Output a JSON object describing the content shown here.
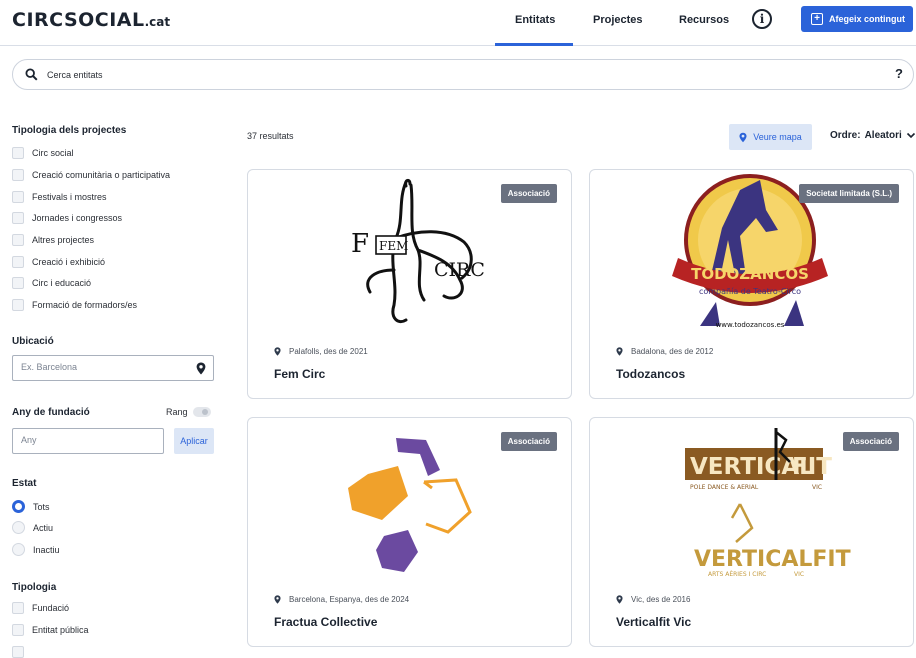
{
  "brand": {
    "name": "CIRCSOCIAL",
    "suffix": ".cat"
  },
  "nav": {
    "tabs": [
      "Entitats",
      "Projectes",
      "Recursos"
    ],
    "active": "Entitats",
    "add_label": "Afegeix contingut",
    "info": "i"
  },
  "search": {
    "placeholder": "Cerca entitats",
    "help": "?"
  },
  "filters": {
    "project_types": {
      "title": "Tipologia dels projectes",
      "items": [
        "Circ social",
        "Creació comunitària o participativa",
        "Festivals i mostres",
        "Jornades i congressos",
        "Altres projectes",
        "Creació i exhibició",
        "Circ i educació",
        "Formació de formadors/es"
      ]
    },
    "location": {
      "title": "Ubicació",
      "placeholder": "Ex. Barcelona"
    },
    "founding": {
      "title": "Any de fundació",
      "range_label": "Rang",
      "placeholder": "Any",
      "apply": "Aplicar"
    },
    "status": {
      "title": "Estat",
      "options": [
        "Tots",
        "Actiu",
        "Inactiu"
      ],
      "selected": "Tots"
    },
    "typology": {
      "title": "Tipologia",
      "items": [
        "Fundació",
        "Entitat pública"
      ]
    }
  },
  "results": {
    "count_text": "37 resultats",
    "map_label": "Veure mapa",
    "order_label": "Ordre:",
    "order_value": "Aleatori"
  },
  "cards": [
    {
      "name": "Fem Circ",
      "meta": "Palafolls, des de 2021",
      "badge": "Associació",
      "logo_text": [
        "FEM",
        "CIRC"
      ]
    },
    {
      "name": "Todozancos",
      "meta": "Badalona, des de 2012",
      "badge": "Societat limitada (S.L.)",
      "logo_text": [
        "TODOZANCOS",
        "compañía de Teatro-Circo",
        "www.todozancos.es"
      ]
    },
    {
      "name": "Fractua Collective",
      "meta": "Barcelona, Espanya, des de 2024",
      "badge": "Associació"
    },
    {
      "name": "Verticalfit Vic",
      "meta": "Vic, des de 2016",
      "badge": "Associació",
      "logo_text": [
        "VERTICAL",
        "FIT",
        "POLE DANCE & AERIAL",
        "VIC",
        "VERTICALFIT",
        "ARTS AÈRIES I CIRC",
        "VIC"
      ]
    }
  ],
  "colors": {
    "accent": "#2b63d9",
    "badge": "#6a7180"
  }
}
